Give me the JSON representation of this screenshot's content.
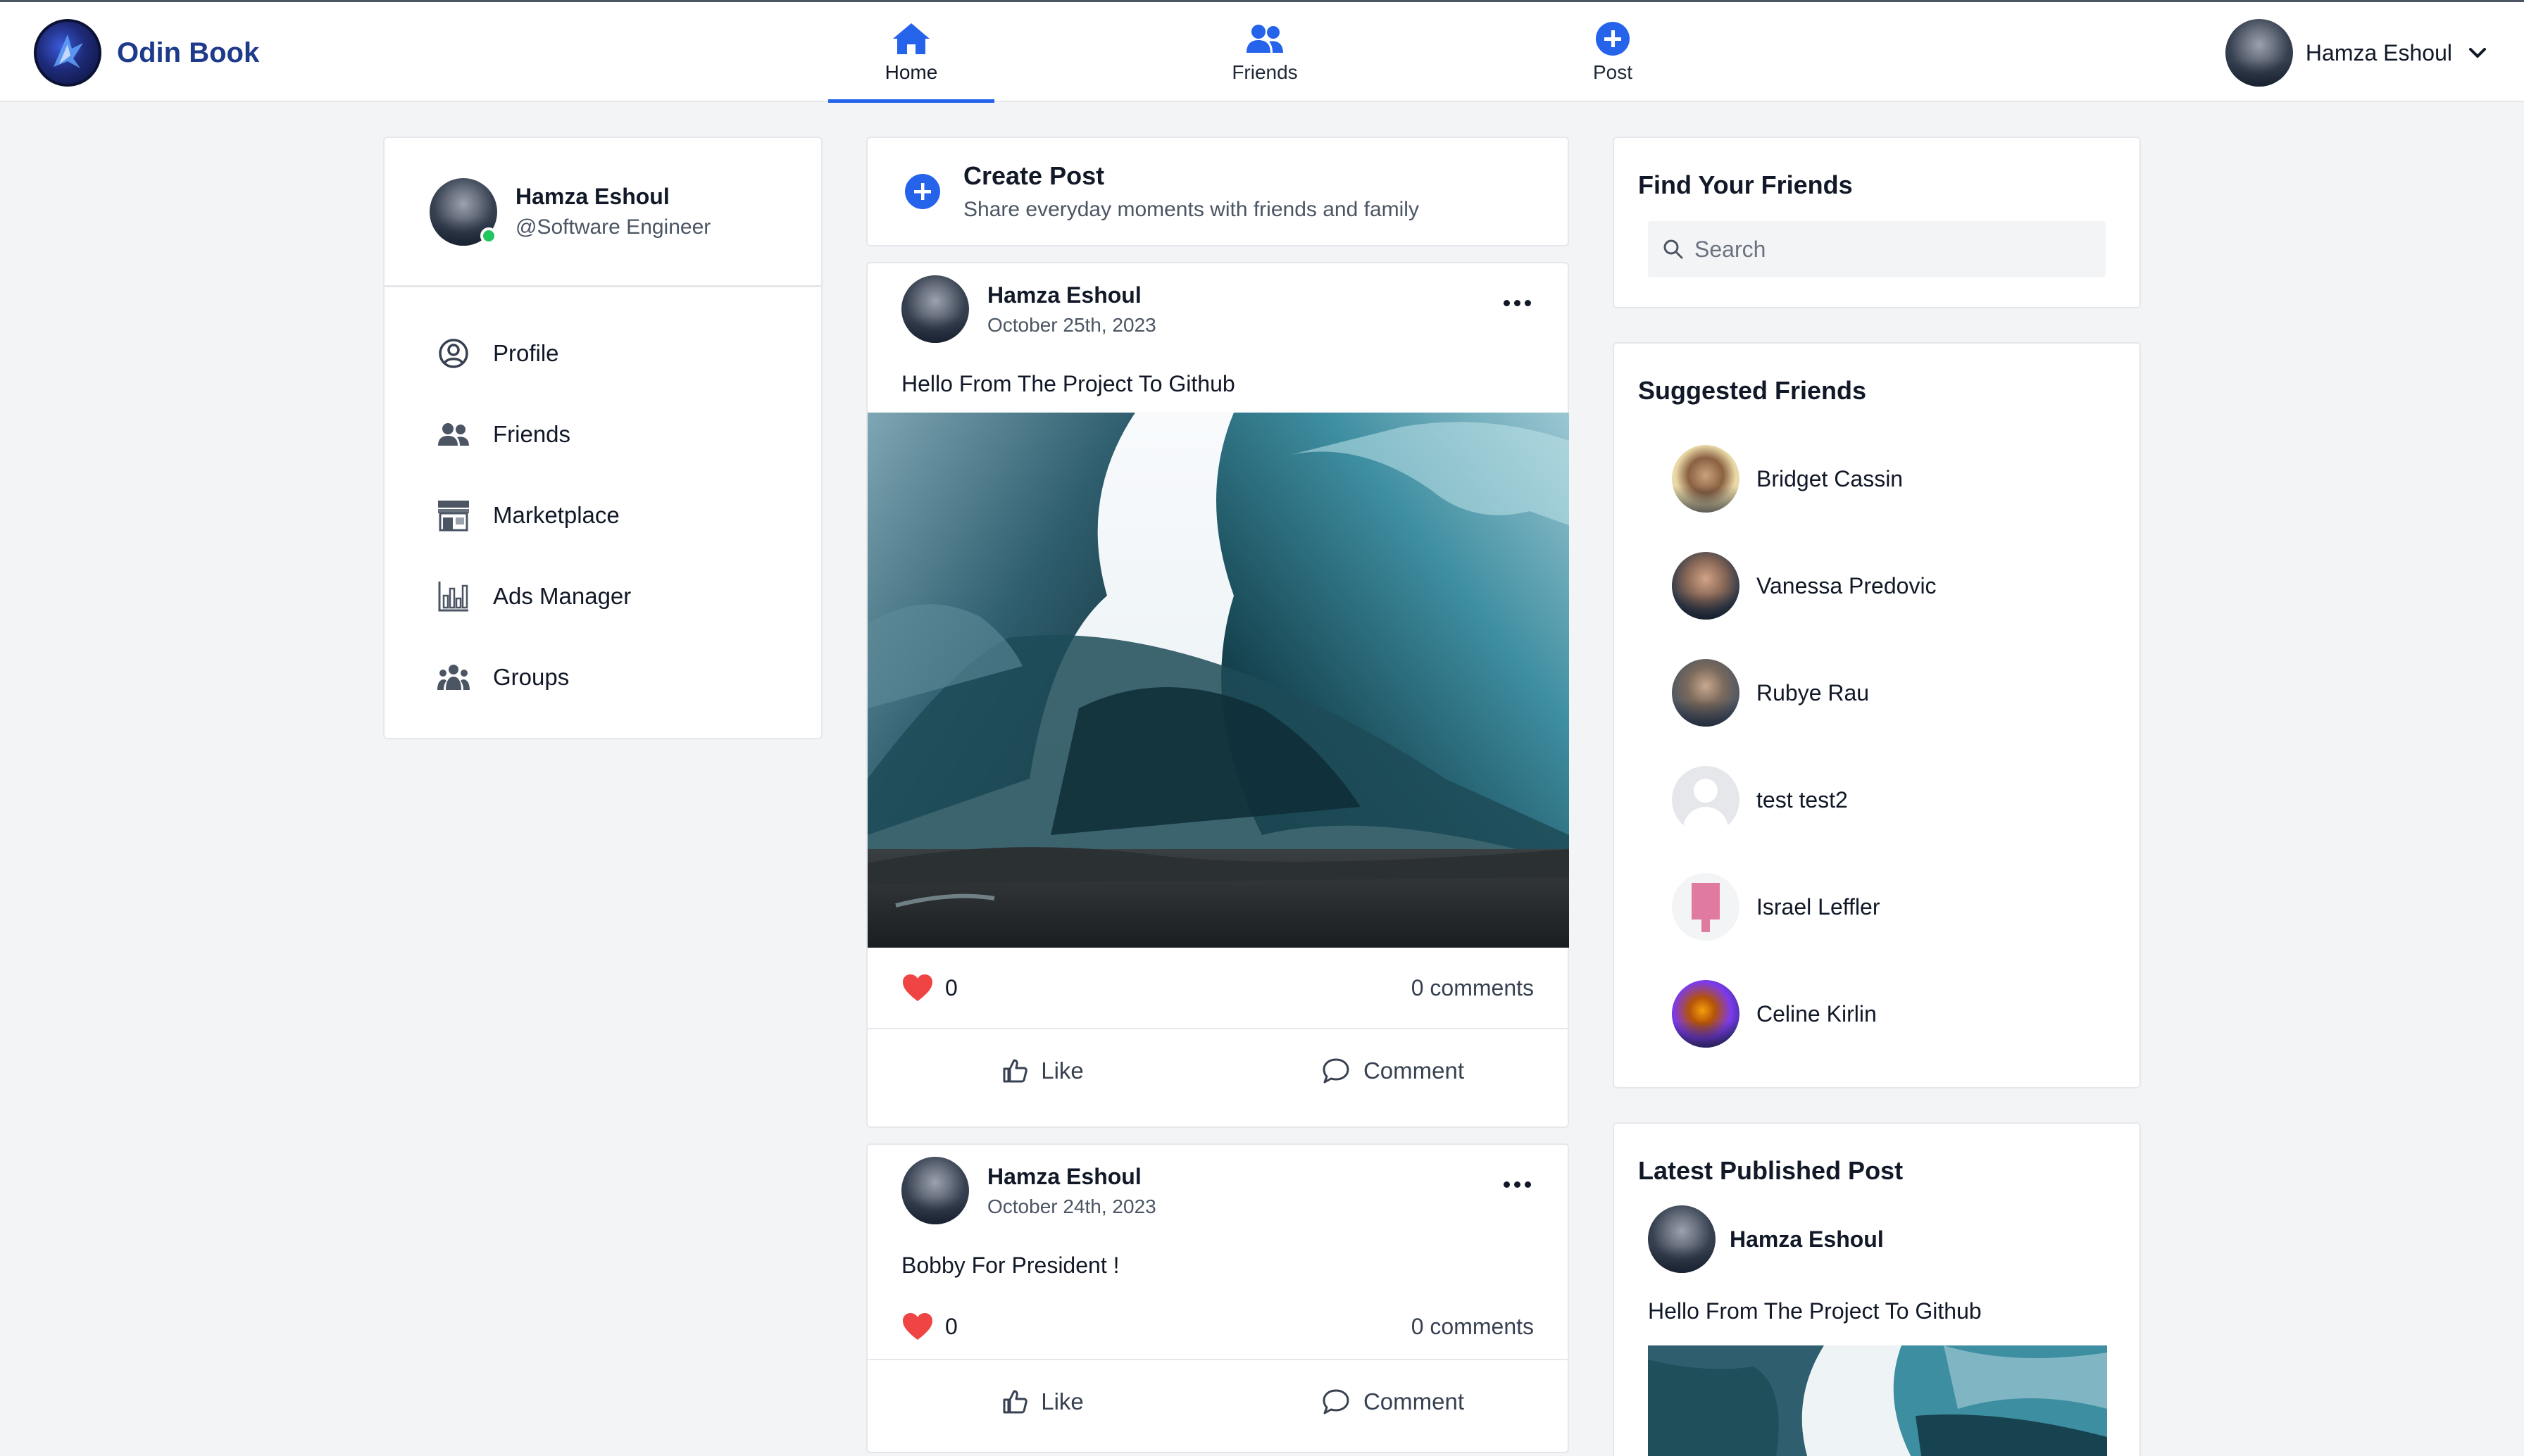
{
  "brand": {
    "name": "Odin Book"
  },
  "nav": {
    "tabs": [
      {
        "label": "Home",
        "icon": "home-icon",
        "active": true
      },
      {
        "label": "Friends",
        "icon": "friends-icon",
        "active": false
      },
      {
        "label": "Post",
        "icon": "plus-circle-icon",
        "active": false
      }
    ]
  },
  "account": {
    "name": "Hamza Eshoul"
  },
  "profile": {
    "name": "Hamza Eshoul",
    "handle": "@Software Engineer",
    "online": true
  },
  "sidebar": {
    "items": [
      {
        "label": "Profile",
        "icon": "user-circle-icon"
      },
      {
        "label": "Friends",
        "icon": "friends-icon"
      },
      {
        "label": "Marketplace",
        "icon": "store-icon"
      },
      {
        "label": "Ads Manager",
        "icon": "bar-chart-icon"
      },
      {
        "label": "Groups",
        "icon": "groups-icon"
      }
    ]
  },
  "create_post": {
    "title": "Create Post",
    "subtitle": "Share everyday moments with friends and family"
  },
  "posts": [
    {
      "author": "Hamza Eshoul",
      "date": "October 25th, 2023",
      "text": "Hello From The Project To Github",
      "has_image": true,
      "likes": "0",
      "comments": "0 comments",
      "like_label": "Like",
      "comment_label": "Comment"
    },
    {
      "author": "Hamza Eshoul",
      "date": "October 24th, 2023",
      "text": "Bobby For President !",
      "has_image": false,
      "likes": "0",
      "comments": "0 comments",
      "like_label": "Like",
      "comment_label": "Comment"
    }
  ],
  "find_friends": {
    "title": "Find Your Friends",
    "placeholder": "Search"
  },
  "suggested": {
    "title": "Suggested Friends",
    "friends": [
      {
        "name": "Bridget Cassin"
      },
      {
        "name": "Vanessa Predovic"
      },
      {
        "name": "Rubye Rau"
      },
      {
        "name": "test test2"
      },
      {
        "name": "Israel Leffler"
      },
      {
        "name": "Celine Kirlin"
      }
    ]
  },
  "latest": {
    "title": "Latest Published Post",
    "author": "Hamza Eshoul",
    "text": "Hello From The Project To Github"
  },
  "colors": {
    "accent": "#2563eb",
    "brand": "#1e3a8a",
    "like": "#ef4444",
    "online": "#22c55e",
    "background": "#f3f4f6"
  }
}
